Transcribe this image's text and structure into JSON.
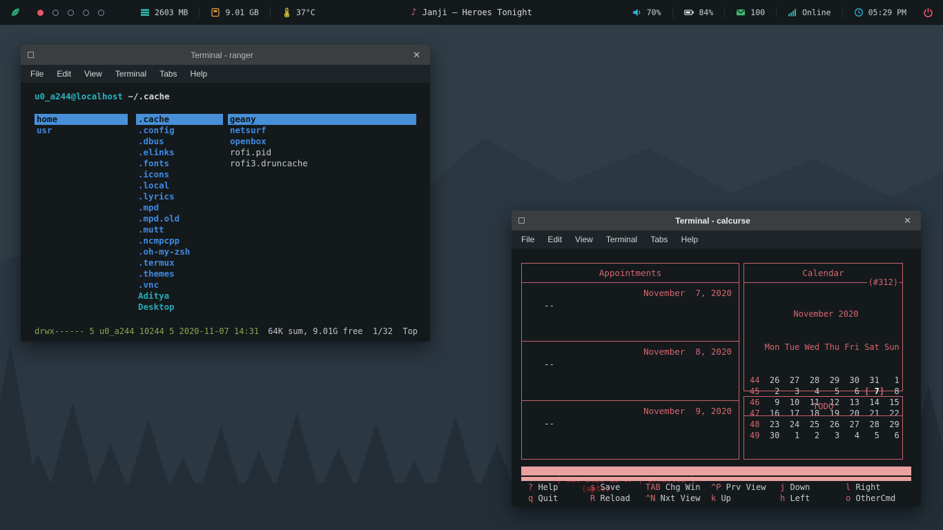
{
  "topbar": {
    "logo_icon": "leaf-icon",
    "workspaces": {
      "count": 5,
      "active_index": 0,
      "active_color": "#e8566c",
      "inactive_color": "#75939d"
    },
    "stats": [
      {
        "icon": "memory-icon",
        "value": "2603 MB",
        "color": "#2fb5ae"
      },
      {
        "icon": "storage-icon",
        "value": "9.01 GB",
        "color": "#e59b3c"
      },
      {
        "icon": "thermometer-icon",
        "value": "37°C",
        "color": "#e5c63c"
      }
    ],
    "now_playing": {
      "icon": "music-note-icon",
      "glyph": "♪",
      "text": "Janji – Heroes Tonight"
    },
    "status": [
      {
        "icon": "volume-icon",
        "value": "70%",
        "color": "#2fb5d6"
      },
      {
        "icon": "battery-icon",
        "value": "84%",
        "color": "#d3d8da"
      },
      {
        "icon": "mail-icon",
        "value": "100",
        "color": "#3cba6c"
      },
      {
        "icon": "network-icon",
        "value": "Online",
        "color": "#2fb5ae"
      },
      {
        "icon": "clock-icon",
        "value": "05:29 PM",
        "color": "#2fb5d6"
      }
    ],
    "power": {
      "icon": "power-icon",
      "color": "#e8566c"
    }
  },
  "chrome": {
    "close_glyph": "✕"
  },
  "ranger": {
    "title": "Terminal - ranger",
    "menu": [
      "File",
      "Edit",
      "View",
      "Terminal",
      "Tabs",
      "Help"
    ],
    "prompt_user": "u0_a244@localhost",
    "prompt_path": "~/.cache",
    "columns": {
      "parent": [
        {
          "label": "home",
          "style": "selected"
        },
        {
          "label": "usr",
          "style": "dir"
        }
      ],
      "current": [
        {
          "label": ".cache",
          "style": "selected"
        },
        {
          "label": ".config",
          "style": "dir"
        },
        {
          "label": ".dbus",
          "style": "dir"
        },
        {
          "label": ".elinks",
          "style": "dir"
        },
        {
          "label": ".fonts",
          "style": "dir"
        },
        {
          "label": ".icons",
          "style": "dir"
        },
        {
          "label": ".local",
          "style": "dir"
        },
        {
          "label": ".lyrics",
          "style": "dir"
        },
        {
          "label": ".mpd",
          "style": "dir"
        },
        {
          "label": ".mpd.old",
          "style": "dir"
        },
        {
          "label": ".mutt",
          "style": "dir"
        },
        {
          "label": ".ncmpcpp",
          "style": "dir"
        },
        {
          "label": ".oh-my-zsh",
          "style": "dir"
        },
        {
          "label": ".termux",
          "style": "dir"
        },
        {
          "label": ".themes",
          "style": "dir"
        },
        {
          "label": ".vnc",
          "style": "dir"
        },
        {
          "label": "Aditya",
          "style": "link"
        },
        {
          "label": "Desktop",
          "style": "link"
        }
      ],
      "preview": [
        {
          "label": "geany",
          "style": "selected"
        },
        {
          "label": "netsurf",
          "style": "dir"
        },
        {
          "label": "openbox",
          "style": "dir"
        },
        {
          "label": "rofi.pid",
          "style": "file"
        },
        {
          "label": "rofi3.druncache",
          "style": "file"
        }
      ]
    },
    "status_left": "drwx------ 5 u0_a244 10244 5 2020-11-07 14:31",
    "status_right": "64K sum, 9.01G free  1/32  Top"
  },
  "calcurse": {
    "title": "Terminal - calcurse",
    "menu": [
      "File",
      "Edit",
      "View",
      "Terminal",
      "Tabs",
      "Help"
    ],
    "appointments": {
      "title": "Appointments",
      "sections": [
        {
          "date": "November  7, 2020",
          "entry": "--"
        },
        {
          "date": "November  8, 2020",
          "entry": "--"
        },
        {
          "date": "November  9, 2020",
          "entry": "--"
        }
      ]
    },
    "calendar": {
      "title": "Calendar",
      "badge": "(#312)",
      "month": "November 2020",
      "weekday_header": "Mon Tue Wed Thu Fri Sat Sun",
      "selected_day": "7",
      "weeks": [
        {
          "num": "44",
          "days": " 26  27  28  29  30  31   1"
        },
        {
          "num": "45",
          "pre": "  2   3   4   5   6 ",
          "sel": "[ 7]",
          "post": "  8"
        },
        {
          "num": "46",
          "days": "  9  10  11  12  13  14  15"
        },
        {
          "num": "47",
          "days": " 16  17  18  19  20  21  22"
        },
        {
          "num": "48",
          "days": " 23  24  25  26  27  28  29"
        },
        {
          "num": "49",
          "days": " 30   1   2   3   4   5   6"
        }
      ]
    },
    "todo": {
      "title": "TODO"
    },
    "statusbar": {
      "text": "[ Sat 2020-11-07 | 17:29:02 ]",
      "mode": "(apts)"
    },
    "keybinds": [
      [
        {
          "key": "?",
          "label": "Help"
        },
        {
          "key": "s",
          "label": "Save"
        },
        {
          "key": "TAB",
          "label": "Chg Win"
        },
        {
          "key": "^P",
          "label": "Prv View"
        },
        {
          "key": "j",
          "label": "Down"
        },
        {
          "key": "l",
          "label": "Right"
        }
      ],
      [
        {
          "key": "q",
          "label": "Quit"
        },
        {
          "key": "R",
          "label": "Reload"
        },
        {
          "key": "^N",
          "label": "Nxt View"
        },
        {
          "key": "k",
          "label": "Up"
        },
        {
          "key": "h",
          "label": "Left"
        },
        {
          "key": "o",
          "label": "OtherCmd"
        }
      ]
    ]
  }
}
